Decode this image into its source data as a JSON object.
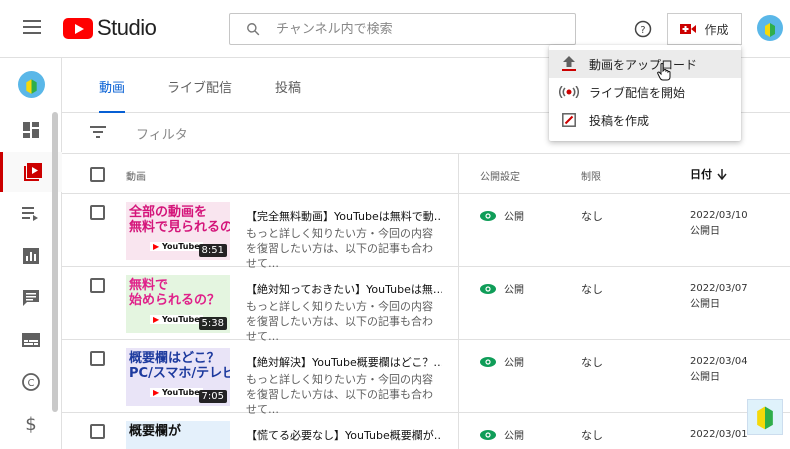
{
  "app": {
    "logo_text": "Studio"
  },
  "search": {
    "placeholder": "チャンネル内で検索"
  },
  "header": {
    "create_label": "作成"
  },
  "tabs": [
    {
      "label": "動画",
      "active": true
    },
    {
      "label": "ライブ配信",
      "active": false
    },
    {
      "label": "投稿",
      "active": false
    }
  ],
  "filter": {
    "label": "フィルタ"
  },
  "table": {
    "headers": {
      "video": "動画",
      "visibility": "公開設定",
      "restrictions": "制限",
      "date": "日付"
    },
    "rows": [
      {
        "title": "【完全無料動画】YouTubeは無料で動…",
        "desc": "もっと詳しく知りたい方・今回の内容を復習したい方は、以下の記事も合わせて…",
        "visibility": "公開",
        "restrictions": "なし",
        "date": "2022/03/10",
        "date_type": "公開日",
        "duration": "8:51",
        "thumb_text": "全部の動画を\n無料で見られるの？"
      },
      {
        "title": "【絶対知っておきたい】YouTubeは無…",
        "desc": "もっと詳しく知りたい方・今回の内容を復習したい方は、以下の記事も合わせて…",
        "visibility": "公開",
        "restrictions": "なし",
        "date": "2022/03/07",
        "date_type": "公開日",
        "duration": "5:38",
        "thumb_text": "無料で\n始められるの？"
      },
      {
        "title": "【絶対解決】YouTube概要欄はどこ？…",
        "desc": "もっと詳しく知りたい方・今回の内容を復習したい方は、以下の記事も合わせて…",
        "visibility": "公開",
        "restrictions": "なし",
        "date": "2022/03/04",
        "date_type": "公開日",
        "duration": "7:05",
        "thumb_text": "概要欄はどこ？\nPC/スマホ/テレビ"
      },
      {
        "title": "【慌てる必要なし】YouTube概要欄が…",
        "desc": "",
        "visibility": "公開",
        "restrictions": "なし",
        "date": "2022/03/01",
        "date_type": "",
        "duration": "",
        "thumb_text": "概要欄が"
      }
    ]
  },
  "create_menu": {
    "items": [
      {
        "label": "動画をアップロード",
        "icon": "upload-icon"
      },
      {
        "label": "ライブ配信を開始",
        "icon": "live-icon"
      },
      {
        "label": "投稿を作成",
        "icon": "post-icon"
      }
    ]
  },
  "colors": {
    "accent": "#065fd4",
    "brand": "#ff0000",
    "active_side": "#cc0000",
    "public_green": "#0f9d58"
  }
}
